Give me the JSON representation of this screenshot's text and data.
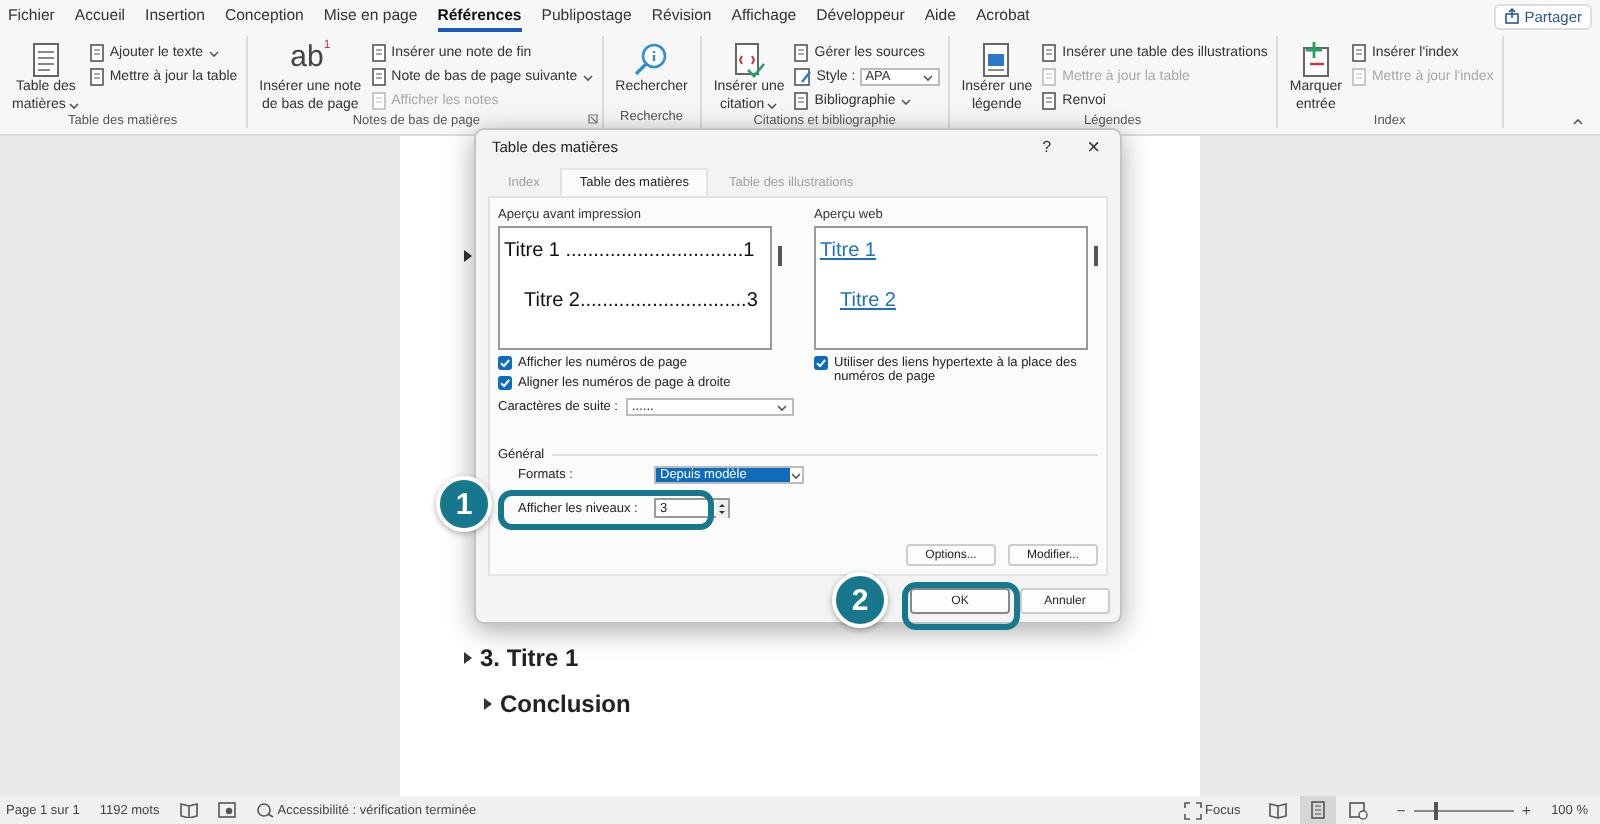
{
  "menu_tabs": [
    {
      "label": "Fichier",
      "selected": false
    },
    {
      "label": "Accueil",
      "selected": false
    },
    {
      "label": "Insertion",
      "selected": false
    },
    {
      "label": "Conception",
      "selected": false
    },
    {
      "label": "Mise en page",
      "selected": false
    },
    {
      "label": "Références",
      "selected": true
    },
    {
      "label": "Publipostage",
      "selected": false
    },
    {
      "label": "Révision",
      "selected": false
    },
    {
      "label": "Affichage",
      "selected": false
    },
    {
      "label": "Développeur",
      "selected": false
    },
    {
      "label": "Aide",
      "selected": false
    },
    {
      "label": "Acrobat",
      "selected": false
    }
  ],
  "share_button": "Partager",
  "ribbon_groups": [
    {
      "title": "Table des matières",
      "launcher": false,
      "large": [
        {
          "kind": "toc",
          "lines": [
            "Table des",
            "matières"
          ],
          "dropdown": true
        }
      ],
      "small": [
        {
          "kind": "button",
          "label": "Ajouter le texte",
          "dropdown": true,
          "disabled": false
        },
        {
          "kind": "button",
          "label": "Mettre à jour la table",
          "dropdown": false,
          "disabled": false
        }
      ]
    },
    {
      "title": "Notes de bas de page",
      "launcher": true,
      "large": [
        {
          "kind": "footnote",
          "glyph": "ab",
          "sup": "1",
          "lines": [
            "Insérer une note",
            "de bas de page"
          ],
          "dropdown": false
        }
      ],
      "small": [
        {
          "kind": "button",
          "label": "Insérer une note de fin",
          "dropdown": false,
          "disabled": false
        },
        {
          "kind": "button",
          "label": "Note de bas de page suivante",
          "dropdown": true,
          "disabled": false
        },
        {
          "kind": "button",
          "label": "Afficher les notes",
          "dropdown": false,
          "disabled": true
        }
      ]
    },
    {
      "title": "Recherche",
      "launcher": false,
      "large": [
        {
          "kind": "search",
          "lines": [
            "Rechercher"
          ],
          "dropdown": false
        }
      ]
    },
    {
      "title": "Citations et bibliographie",
      "launcher": false,
      "large": [
        {
          "kind": "citation",
          "lines": [
            "Insérer une",
            "citation"
          ],
          "dropdown": true
        }
      ],
      "small": [
        {
          "kind": "button",
          "label": "Gérer les sources",
          "dropdown": false,
          "disabled": false
        },
        {
          "kind": "select",
          "label": "Style :",
          "value": "APA"
        },
        {
          "kind": "button",
          "label": "Bibliographie",
          "dropdown": true,
          "disabled": false
        }
      ]
    },
    {
      "title": "Légendes",
      "launcher": false,
      "large": [
        {
          "kind": "caption",
          "lines": [
            "Insérer une",
            "légende"
          ],
          "dropdown": false
        }
      ],
      "small": [
        {
          "kind": "button",
          "label": "Insérer une table des illustrations",
          "dropdown": false,
          "disabled": false
        },
        {
          "kind": "button",
          "label": "Mettre à jour la table",
          "dropdown": false,
          "disabled": true
        },
        {
          "kind": "button",
          "label": "Renvoi",
          "dropdown": false,
          "disabled": false
        }
      ]
    },
    {
      "title": "Index",
      "launcher": false,
      "large": [
        {
          "kind": "mark",
          "lines": [
            "Marquer",
            "entrée"
          ],
          "dropdown": false
        }
      ],
      "small": [
        {
          "kind": "button",
          "label": "Insérer l'index",
          "dropdown": false,
          "disabled": false
        },
        {
          "kind": "button",
          "label": "Mettre à jour l'index",
          "dropdown": false,
          "disabled": true
        }
      ]
    }
  ],
  "document": {
    "headings": [
      {
        "text": "3. Titre 1",
        "children": [
          {
            "text": "Conclusion"
          }
        ]
      }
    ]
  },
  "dialog": {
    "title": "Table des matières",
    "help": "?",
    "close": "×",
    "tabs": [
      {
        "label": "Index",
        "selected": false
      },
      {
        "label": "Table des matières",
        "selected": true
      },
      {
        "label": "Table des illustrations",
        "selected": false
      }
    ],
    "print_preview": {
      "label": "Aperçu avant impression",
      "entries": [
        "Titre 1 ................................1",
        "Titre 2..............................3"
      ]
    },
    "print_options": [
      {
        "label": "Afficher les numéros de page",
        "checked": true
      },
      {
        "label": "Aligner les numéros de page à droite",
        "checked": true
      }
    ],
    "leader": {
      "label": "Caractères de suite :",
      "value": "......"
    },
    "web_preview": {
      "label": "Aperçu web",
      "links": [
        "Titre 1",
        "Titre 2"
      ]
    },
    "web_options": [
      {
        "label": "Utiliser des liens hypertexte à la place des numéros de page",
        "checked": true
      }
    ],
    "general": {
      "label": "Général",
      "formats_label": "Formats :",
      "formats_value": "Depuis modèle",
      "levels_label": "Afficher les niveaux :",
      "levels_value": "3"
    },
    "panel_buttons": [
      "Options...",
      "Modifier..."
    ],
    "buttons": [
      "OK",
      "Annuler"
    ]
  },
  "callouts": [
    {
      "number": "1"
    },
    {
      "number": "2"
    }
  ],
  "status_bar": {
    "page": "Page 1 sur 1",
    "words": "1192 mots",
    "accessibility": "Accessibilité : vérification terminée",
    "focus": "Focus",
    "views": [
      {
        "kind": "read",
        "selected": false
      },
      {
        "kind": "print",
        "selected": true
      },
      {
        "kind": "web",
        "selected": false
      }
    ],
    "zoom_out": "−",
    "zoom_in": "+",
    "zoom": {
      "level": 0.22
    },
    "zoom_text": "100 %"
  }
}
